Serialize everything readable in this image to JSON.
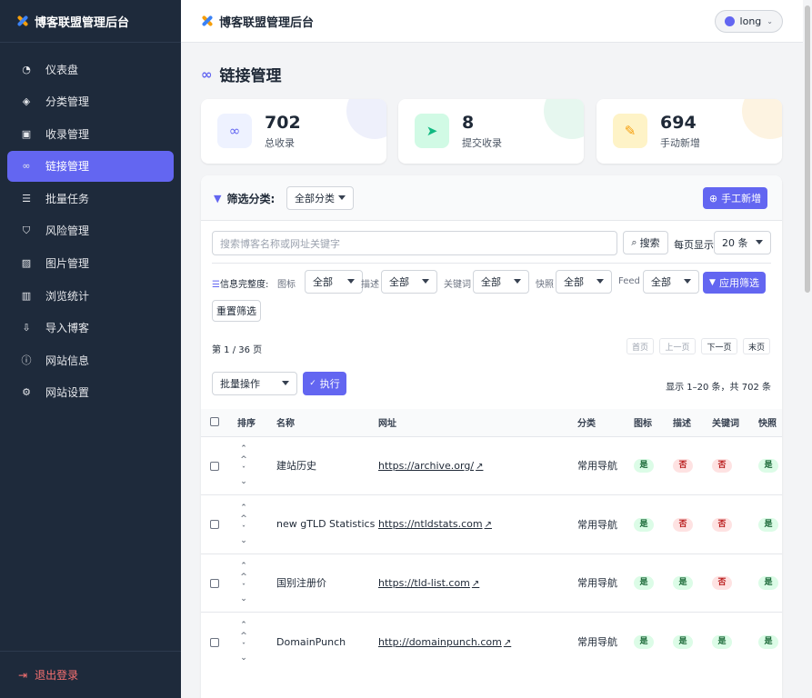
{
  "app": {
    "title": "博客联盟管理后台"
  },
  "colors": {
    "accent": "#6366f1",
    "sidebar_bg": "#1e2a3b",
    "danger": "#f87171"
  },
  "sidebar": {
    "brand": "博客联盟管理后台",
    "items": [
      {
        "label": "仪表盘",
        "icon": "gauge-icon",
        "glyph": "◔"
      },
      {
        "label": "分类管理",
        "icon": "layers-icon",
        "glyph": "◈"
      },
      {
        "label": "收录管理",
        "icon": "clipboard-check-icon",
        "glyph": "▣"
      },
      {
        "label": "链接管理",
        "icon": "link-icon",
        "glyph": "∞",
        "active": true
      },
      {
        "label": "批量任务",
        "icon": "list-check-icon",
        "glyph": "☰"
      },
      {
        "label": "风险管理",
        "icon": "shield-icon",
        "glyph": "⛉"
      },
      {
        "label": "图片管理",
        "icon": "images-icon",
        "glyph": "▨"
      },
      {
        "label": "浏览统计",
        "icon": "chart-icon",
        "glyph": "▥"
      },
      {
        "label": "导入博客",
        "icon": "file-import-icon",
        "glyph": "⇩"
      },
      {
        "label": "网站信息",
        "icon": "info-icon",
        "glyph": "ⓘ"
      },
      {
        "label": "网站设置",
        "icon": "gear-icon",
        "glyph": "⚙"
      }
    ],
    "logout": "退出登录"
  },
  "header": {
    "title": "博客联盟管理后台",
    "user": "long"
  },
  "page": {
    "title": "链接管理"
  },
  "stats": [
    {
      "value": "702",
      "label": "总收录",
      "icon": "link-icon",
      "glyph": "∞",
      "color": "#6366f1",
      "bg": "#eef2ff",
      "blob": "#eef0fb"
    },
    {
      "value": "8",
      "label": "提交收录",
      "icon": "paper-plane-icon",
      "glyph": "➤",
      "color": "#10b981",
      "bg": "#d1fae5",
      "blob": "#e6f7ef"
    },
    {
      "value": "694",
      "label": "手动新增",
      "icon": "pencil-icon",
      "glyph": "✎",
      "color": "#f59e0b",
      "bg": "#fef3c7",
      "blob": "#fdf3e1"
    }
  ],
  "filter": {
    "label": "筛选分类:",
    "category": "全部分类",
    "add_button": "手工新增",
    "search_placeholder": "搜索博客名称或网址关键字",
    "search_button": "搜索",
    "per_page_label": "每页显示",
    "per_page": "20 条",
    "completeness_label": "信息完整度:",
    "fields": [
      {
        "label": "图标",
        "value": "全部"
      },
      {
        "label": "描述",
        "value": "全部"
      },
      {
        "label": "关键词",
        "value": "全部"
      },
      {
        "label": "快照",
        "value": "全部"
      },
      {
        "label": "Feed",
        "value": "全部"
      }
    ],
    "apply_button": "应用筛选",
    "reset_button": "重置筛选"
  },
  "pagination": {
    "info": "第 1 / 36 页",
    "first": "首页",
    "prev": "上一页",
    "next": "下一页",
    "last": "末页"
  },
  "bulk": {
    "select": "批量操作",
    "execute": "执行",
    "summary": "显示 1–20 条，共 702 条"
  },
  "table": {
    "headers": [
      "排序",
      "名称",
      "网址",
      "分类",
      "图标",
      "描述",
      "关键词",
      "快照"
    ],
    "rows": [
      {
        "name": "建站历史",
        "url": "https://archive.org/",
        "category": "常用导航",
        "icon": "是",
        "desc": "否",
        "keywords": "否",
        "snapshot": "是"
      },
      {
        "name": "new gTLD Statistics",
        "url": "https://ntldstats.com",
        "category": "常用导航",
        "icon": "是",
        "desc": "否",
        "keywords": "否",
        "snapshot": "是"
      },
      {
        "name": "国别注册价",
        "url": "https://tld-list.com",
        "category": "常用导航",
        "icon": "是",
        "desc": "是",
        "keywords": "否",
        "snapshot": "是"
      },
      {
        "name": "DomainPunch",
        "url": "http://domainpunch.com",
        "category": "常用导航",
        "icon": "是",
        "desc": "是",
        "keywords": "是",
        "snapshot": "是"
      }
    ]
  }
}
